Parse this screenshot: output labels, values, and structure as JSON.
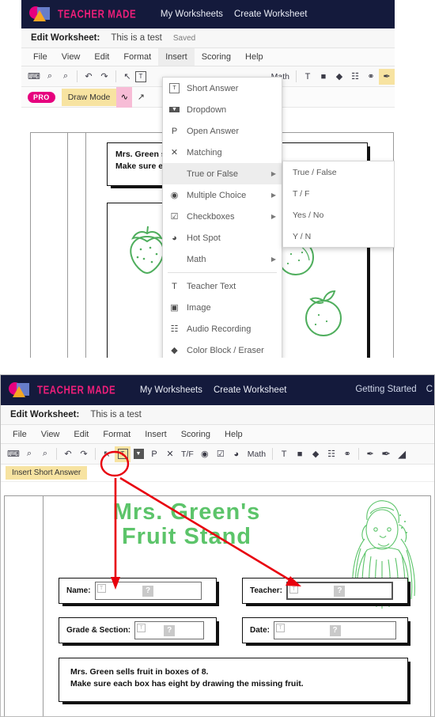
{
  "brand": {
    "name": "TEACHER MADE",
    "accent": "#ec1e79",
    "navbar_bg": "#141a3c"
  },
  "nav": {
    "links": [
      "My Worksheets",
      "Create Worksheet"
    ],
    "right_links": [
      "Getting Started",
      "C"
    ]
  },
  "worksheet_bar": {
    "label": "Edit Worksheet:",
    "title": "This is a test",
    "saved": "Saved"
  },
  "menubar": {
    "items": [
      "File",
      "View",
      "Edit",
      "Format",
      "Insert",
      "Scoring",
      "Help"
    ],
    "active_panel1": "Insert",
    "active_panel2": "Format"
  },
  "toolbar": {
    "icons": [
      {
        "name": "preview-icon",
        "glyph": "⌨"
      },
      {
        "name": "zoom-in-icon",
        "glyph": "⌕"
      },
      {
        "name": "zoom-out-icon",
        "glyph": "⌕"
      },
      {
        "name": "undo-icon",
        "glyph": "↶"
      },
      {
        "name": "redo-icon",
        "glyph": "↷"
      },
      {
        "name": "select-cursor-icon",
        "glyph": "↖"
      },
      {
        "name": "short-answer-icon",
        "glyph": "T"
      },
      {
        "name": "dropdown-icon",
        "glyph": "▼"
      },
      {
        "name": "open-answer-icon",
        "glyph": "P"
      },
      {
        "name": "matching-icon",
        "glyph": "✕"
      },
      {
        "name": "true-false-icon",
        "glyph": "T/F"
      },
      {
        "name": "multiple-choice-icon",
        "glyph": "◉"
      },
      {
        "name": "checkboxes-icon",
        "glyph": "☑"
      },
      {
        "name": "hot-spot-icon",
        "glyph": "◕"
      },
      {
        "name": "math-icon",
        "glyph": "Math"
      },
      {
        "name": "teacher-text-icon",
        "glyph": "T"
      },
      {
        "name": "image-icon",
        "glyph": "■"
      },
      {
        "name": "color-block-eraser-icon",
        "glyph": "◆"
      },
      {
        "name": "audio-recording-icon",
        "glyph": "☷"
      },
      {
        "name": "link-icon",
        "glyph": "⚭"
      },
      {
        "name": "pen-thin-icon",
        "glyph": "✒"
      },
      {
        "name": "pen-thick-icon",
        "glyph": "✒"
      },
      {
        "name": "highlighter-icon",
        "glyph": "◢"
      }
    ],
    "tooltip": "Insert Short Answer"
  },
  "drawbar": {
    "pro_badge": "PRO",
    "draw_mode": "Draw Mode",
    "freehand_icon": "freehand-draw-icon",
    "line_icon": "line-draw-icon"
  },
  "insert_menu": {
    "items": [
      {
        "label": "Short Answer",
        "icon": "short-answer-icon",
        "glyph": "T",
        "submenu": false
      },
      {
        "label": "Dropdown",
        "icon": "dropdown-icon",
        "glyph": "▼",
        "submenu": false
      },
      {
        "label": "Open Answer",
        "icon": "open-answer-icon",
        "glyph": "P",
        "submenu": false
      },
      {
        "label": "Matching",
        "icon": "matching-icon",
        "glyph": "✕",
        "submenu": false
      },
      {
        "label": "True or False",
        "icon": "true-false-icon",
        "glyph": "",
        "submenu": true,
        "selected": true
      },
      {
        "label": "Multiple Choice",
        "icon": "multiple-choice-icon",
        "glyph": "◉",
        "submenu": true
      },
      {
        "label": "Checkboxes",
        "icon": "checkboxes-icon",
        "glyph": "☑",
        "submenu": true
      },
      {
        "label": "Hot Spot",
        "icon": "hot-spot-icon",
        "glyph": "◕",
        "submenu": false
      },
      {
        "label": "Math",
        "icon": "math-icon",
        "glyph": "",
        "submenu": true
      },
      {
        "label": "Teacher Text",
        "icon": "teacher-text-icon",
        "glyph": "T",
        "submenu": false,
        "divider_before": true
      },
      {
        "label": "Image",
        "icon": "image-icon",
        "glyph": "▣",
        "submenu": false
      },
      {
        "label": "Audio Recording",
        "icon": "audio-recording-icon",
        "glyph": "☷",
        "submenu": false
      },
      {
        "label": "Color Block / Eraser",
        "icon": "color-block-eraser-icon",
        "glyph": "◆",
        "submenu": false
      }
    ]
  },
  "true_false_submenu": {
    "items": [
      "True / False",
      "T / F",
      "Yes / No",
      "Y / N"
    ]
  },
  "worksheet": {
    "title_line1": "Mrs. Green's",
    "title_line2": "Fruit Stand",
    "title_color": "#5cc46a",
    "instructions_line1": "Mrs. Green sells fruit in boxes of 8.",
    "instructions_line2": "Make sure each box has eight by drawing the missing fruit.",
    "fields": [
      {
        "label": "Name:",
        "placeholder": "?"
      },
      {
        "label": "Teacher:",
        "placeholder": "?"
      },
      {
        "label": "Grade & Section:",
        "placeholder": "?"
      },
      {
        "label": "Date:",
        "placeholder": "?"
      }
    ],
    "answer_icon": "short-answer-field-icon"
  },
  "annotations": {
    "ellipse": {
      "name": "highlight-ellipse",
      "color": "#e8000d"
    },
    "arrows": [
      {
        "name": "arrow-to-name-field",
        "color": "#e8000d"
      },
      {
        "name": "arrow-to-teacher-field",
        "color": "#e8000d"
      }
    ]
  }
}
